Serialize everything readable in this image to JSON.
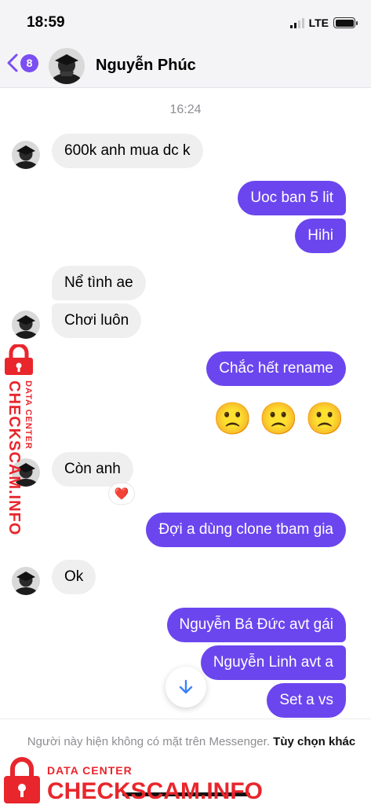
{
  "status_bar": {
    "time": "18:59",
    "network": "LTE"
  },
  "header": {
    "back_badge": "8",
    "contact_name": "Nguyễn Phúc"
  },
  "conversation": {
    "timestamp": "16:24",
    "messages": [
      {
        "text": "600k anh mua dc k"
      },
      {
        "text": "Uoc ban 5 lit"
      },
      {
        "text": "Hihi"
      },
      {
        "text": "Nể tình ae"
      },
      {
        "text": "Chơi luôn"
      },
      {
        "text": "Chắc hết rename"
      },
      {
        "text": "🙁"
      },
      {
        "text": "🙁"
      },
      {
        "text": "🙁"
      },
      {
        "text": "Còn anh"
      },
      {
        "text": "Đợi a dùng clone tbam gia"
      },
      {
        "text": "Ok"
      },
      {
        "text": "Nguyễn Bá Đức avt gái"
      },
      {
        "text": "Nguyễn Linh avt a"
      },
      {
        "text": "Set a vs"
      }
    ],
    "reaction": "❤️"
  },
  "bottom_notice": {
    "text": "Người này hiện không có mặt trên Messenger.",
    "link": "Tùy chọn khác"
  },
  "watermark": {
    "small_text": "DATA CENTER",
    "big_text": "CHECKSCAM.INFO"
  },
  "colors": {
    "outgoing_bubble": "#6b46ee",
    "incoming_bubble": "#efefef",
    "accent": "#7b4ef3",
    "watermark": "#e8262c"
  }
}
